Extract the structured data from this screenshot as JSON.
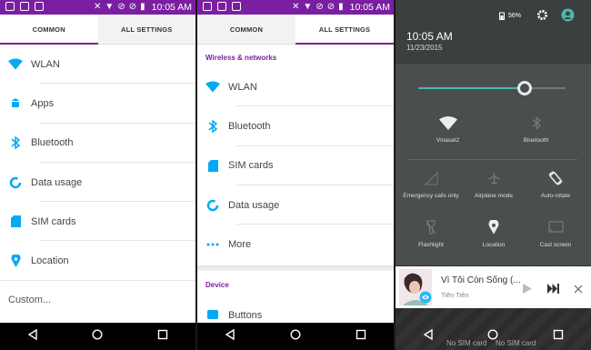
{
  "status_bar": {
    "time": "10:05 AM"
  },
  "screen1": {
    "tabs": {
      "common": "COMMON",
      "all_settings": "ALL SETTINGS"
    },
    "items": [
      {
        "label": "WLAN",
        "icon": "wifi-icon"
      },
      {
        "label": "Apps",
        "icon": "android-icon"
      },
      {
        "label": "Bluetooth",
        "icon": "bluetooth-icon"
      },
      {
        "label": "Data usage",
        "icon": "data-usage-icon"
      },
      {
        "label": "SIM cards",
        "icon": "sim-card-icon"
      },
      {
        "label": "Location",
        "icon": "location-icon"
      }
    ],
    "custom": "Custom..."
  },
  "screen2": {
    "tabs": {
      "common": "COMMON",
      "all_settings": "ALL SETTINGS"
    },
    "section_wireless": "Wireless & networks",
    "items": [
      {
        "label": "WLAN",
        "icon": "wifi-icon"
      },
      {
        "label": "Bluetooth",
        "icon": "bluetooth-icon"
      },
      {
        "label": "SIM cards",
        "icon": "sim-card-icon"
      },
      {
        "label": "Data usage",
        "icon": "data-usage-icon"
      },
      {
        "label": "More",
        "icon": "more-dots-icon"
      }
    ],
    "section_device": "Device",
    "buttons_label": "Buttons"
  },
  "screen3": {
    "time": "10:05 AM",
    "date": "11/23/2015",
    "battery": "56%",
    "brightness": 0.72,
    "tiles": [
      {
        "label": "Vinasat2",
        "icon": "wifi-icon"
      },
      {
        "label": "Bluetooth",
        "icon": "bluetooth-off-icon"
      },
      {
        "label": "Emergency calls only",
        "icon": "signal-icon"
      },
      {
        "label": "Airplane mode",
        "icon": "airplane-icon"
      },
      {
        "label": "Auto-rotate",
        "icon": "auto-rotate-icon"
      },
      {
        "label": "Flashlight",
        "icon": "flashlight-icon"
      },
      {
        "label": "Location",
        "icon": "location-icon"
      },
      {
        "label": "Cast screen",
        "icon": "cast-icon"
      }
    ],
    "notification": {
      "title": "Vì Tôi Còn Sống (...",
      "artist": "Tiên Tiên"
    },
    "sim_left": "No SIM card",
    "sim_right": "No SIM card"
  },
  "colors": {
    "accent": "#7b1fa2",
    "icon_blue": "#03a9f4",
    "teal": "#4db6ac"
  }
}
